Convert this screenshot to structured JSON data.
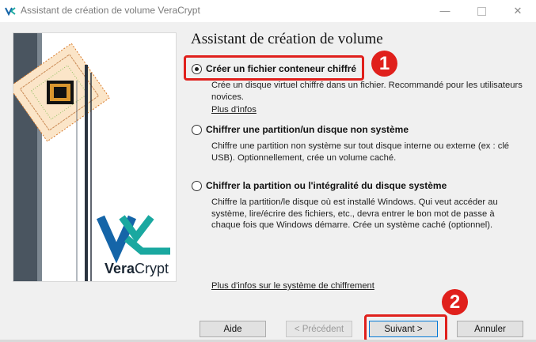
{
  "window": {
    "title": "Assistant de création de volume VeraCrypt",
    "minimize_glyph": "—",
    "close_glyph": "✕"
  },
  "brand": {
    "name_part1": "Vera",
    "name_part2": "Crypt"
  },
  "wizard": {
    "heading": "Assistant de création de volume",
    "options": [
      {
        "label": "Créer un fichier conteneur chiffré",
        "selected": true,
        "description": "Crée un disque virtuel chiffré dans un fichier. Recommandé pour les utilisateurs novices.",
        "link": "Plus d'infos"
      },
      {
        "label": "Chiffrer une partition/un disque non système",
        "selected": false,
        "description": "Chiffre une partition non système sur tout disque interne ou externe (ex : clé USB). Optionnellement, crée un volume caché."
      },
      {
        "label": "Chiffrer la partition ou l'intégralité du disque système",
        "selected": false,
        "description": "Chiffre la partition/le disque où est installé Windows. Qui veut accéder au système, lire/écrire des fichiers, etc., devra entrer le bon mot de passe à chaque fois que Windows démarre. Crée un système caché (optionnel)."
      }
    ],
    "encryption_link": "Plus d'infos sur le système de chiffrement"
  },
  "buttons": {
    "help": "Aide",
    "previous": "< Précédent",
    "next": "Suivant >",
    "cancel": "Annuler"
  },
  "annotations": {
    "step1": "1",
    "step2": "2",
    "color": "#e0201c"
  },
  "colors": {
    "brand_teal": "#1aa8a0",
    "brand_blue": "#1565a8",
    "chip_orange": "#d87a2b"
  }
}
